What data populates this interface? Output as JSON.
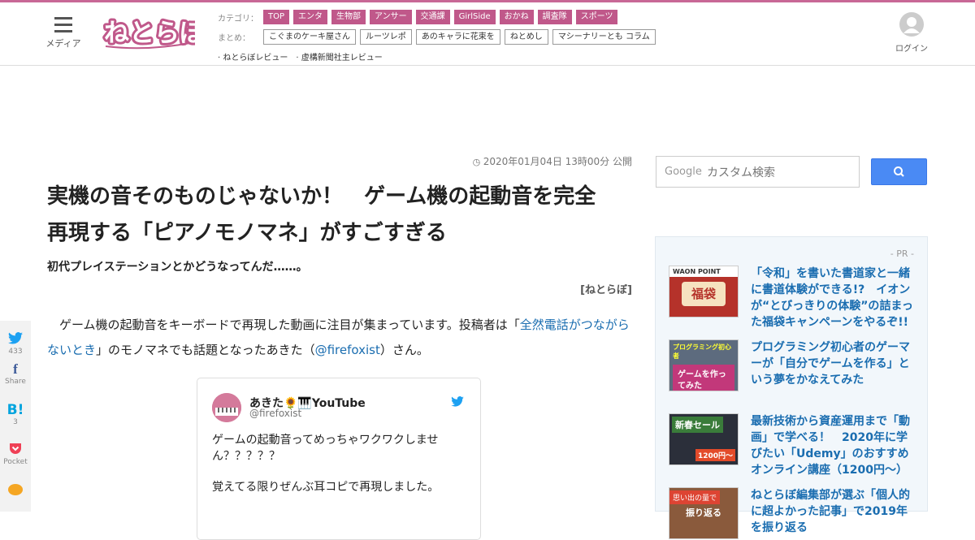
{
  "header": {
    "menu_label": "メディア",
    "logo_text": "ねとらぼ",
    "category_label": "カテゴリ：",
    "categories": [
      "TOP",
      "エンタ",
      "生物部",
      "アンサー",
      "交通課",
      "GirlSide",
      "おかね",
      "調査隊",
      "スポーツ"
    ],
    "matome_label": "まとめ：",
    "matome": [
      "こぐまのケーキ屋さん",
      "ルーツレポ",
      "あのキャラに花束を",
      "ねとめし",
      "マシーナリーとも コラム"
    ],
    "extra_links": [
      "· ねとらぼレビュー",
      "· 虚構新聞社主レビュー"
    ],
    "login_label": "ログイン"
  },
  "share": {
    "twitter_count": "433",
    "facebook_label": "Share",
    "hatena_count": "3",
    "pocket_label": "Pocket"
  },
  "article": {
    "date": "2020年01月04日 13時00分 公開",
    "title_line1": "実機の音そのものじゃないか！　ゲーム機の起動音を完全",
    "title_line2": "再現する「ピアノモノマネ」がすごすぎる",
    "subtitle": "初代プレイステーションとかどうなってんだ……。",
    "source": "[ねとらぼ]",
    "body_part1": "ゲーム機の起動音をキーボードで再現した動画に注目が集まっています。投稿者は「",
    "body_link1": "全然電話がつながらないとき",
    "body_part2": "」のモノマネでも話題となったあきた（",
    "body_link2": "@firefoxist",
    "body_part3": "）さん。"
  },
  "tweet": {
    "name": "あきた🌻🎹YouTube",
    "handle": "@firefoxist",
    "text1": "ゲームの起動音ってめっちゃワクワクしません？？？？？",
    "text2": "覚えてる限りぜんぶ耳コピで再現しました。"
  },
  "search": {
    "google_label": "Google",
    "placeholder": "カスタム検索"
  },
  "pr": {
    "label": "- PR -",
    "items": [
      {
        "title": "「令和」を書いた書道家と一緒に書道体験ができる!?　イオンが“とびっきりの体験”の詰まった福袋キャンペーンをやるぞ!!",
        "thumb_text": "福袋",
        "thumb_caption": "WAON POINT"
      },
      {
        "title": "プログラミング初心者のゲーマーが「自分でゲームを作る」という夢をかなえてみた",
        "thumb_text": "ゲームを作ってみた",
        "thumb_caption": "プログラミング初心者"
      },
      {
        "title": "最新技術から資産運用まで「動画」で学べる！　2020年に学びたい「Udemy」のおすすめオンライン講座（1200円～）",
        "thumb_text": "新春セール",
        "thumb_caption": "1200円～"
      },
      {
        "title": "ねとらぼ編集部が選ぶ「個人的に超よかった記事」で2019年を振り返る",
        "thumb_text": "振り返る",
        "thumb_caption": "思い出の量で"
      }
    ]
  },
  "colors": {
    "brand": "#c0588a",
    "link": "#1a6db0",
    "search_button": "#4a8af4"
  }
}
